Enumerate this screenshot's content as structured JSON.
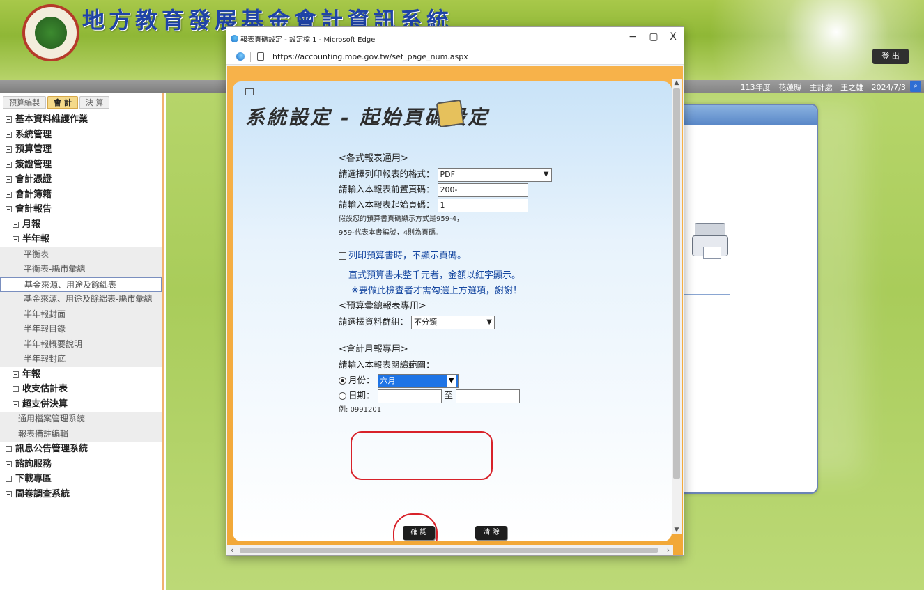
{
  "header": {
    "system_title": "地方教育發展基金會計資訊系統",
    "logout_label": "登 出",
    "colors": {
      "banner": "#a8c84a",
      "title": "#1f43a6"
    }
  },
  "infobar": {
    "year": "113年度",
    "county": "花蓮縣",
    "role": "主計處",
    "user": "王之雄",
    "date": "2024/7/3",
    "search_icon": "search-icon"
  },
  "sidebar": {
    "tabs": [
      "預算編製",
      "會 計",
      "決 算"
    ],
    "items": [
      {
        "label": "基本資料維護作業",
        "kind": "lvl1"
      },
      {
        "label": "系統管理",
        "kind": "lvl1"
      },
      {
        "label": "預算管理",
        "kind": "lvl1"
      },
      {
        "label": "簽證管理",
        "kind": "lvl1"
      },
      {
        "label": "會計憑證",
        "kind": "lvl1"
      },
      {
        "label": "會計簿籍",
        "kind": "lvl1"
      },
      {
        "label": "會計報告",
        "kind": "lvl1"
      },
      {
        "label": "月報",
        "kind": "lvl2"
      },
      {
        "label": "半年報",
        "kind": "lvl2"
      },
      {
        "label": "平衡表",
        "kind": "sub"
      },
      {
        "label": "平衡表-縣市彙總",
        "kind": "sub"
      },
      {
        "label": "基金來源、用途及餘絀表",
        "kind": "sub",
        "selected": true
      },
      {
        "label": "基金來源、用途及餘絀表-縣市彙總",
        "kind": "sub"
      },
      {
        "label": "半年報封面",
        "kind": "sub"
      },
      {
        "label": "半年報目錄",
        "kind": "sub"
      },
      {
        "label": "半年報概要說明",
        "kind": "sub"
      },
      {
        "label": "半年報封底",
        "kind": "sub"
      },
      {
        "label": "年報",
        "kind": "lvl2"
      },
      {
        "label": "收支估計表",
        "kind": "lvl2"
      },
      {
        "label": "超支併決算",
        "kind": "lvl2"
      },
      {
        "label": "通用檔案管理系統",
        "kind": "misc"
      },
      {
        "label": "報表備註編輯",
        "kind": "misc"
      },
      {
        "label": "訊息公告管理系統",
        "kind": "lvl1"
      },
      {
        "label": "諮詢服務",
        "kind": "lvl1"
      },
      {
        "label": "下載專區",
        "kind": "lvl1"
      },
      {
        "label": "問卷調查系統",
        "kind": "lvl1"
      }
    ]
  },
  "edge": {
    "window_title": "報表頁碼設定 - 設定檔 1 - Microsoft Edge",
    "url": "https://accounting.moe.gov.tw/set_page_num.aspx",
    "minimize": "−",
    "maximize": "▢",
    "close": "X"
  },
  "dialog": {
    "page_title": "系統設定 - 起始頁碼設定",
    "section_common": "<各式報表通用>",
    "format_label": "請選擇列印報表的格式：",
    "format_value": "PDF",
    "prefix_label": "請輸入本報表前置頁碼：",
    "prefix_value": "200-",
    "start_label": "請輸入本報表起始頁碼：",
    "start_value": "1",
    "note_line1": "假設您的預算書頁碼顯示方式是959-4，",
    "note_line2": "959-代表本書編號，4則為頁碼。",
    "checkbox1": "列印預算書時，不顯示頁碼。",
    "checkbox2": "直式預算書未整千元者，金額以紅字顯示。",
    "notice": "※要做此檢查者才需勾選上方選項，謝謝！",
    "section_budget": "<預算彙總報表專用>",
    "group_label": "請選擇資料群組：",
    "group_value": "不分類",
    "section_monthly": "<會計月報專用>",
    "range_label": "請輸入本報表閱讀範圍：",
    "month_label": "月份：",
    "month_value": "六月",
    "date_label": "日期：",
    "date_to": "至",
    "date_example": "例: 0991201",
    "confirm": "確 認",
    "clear": "清 除",
    "colors": {
      "highlight_oval": "#d8222a",
      "selected_option": "#1e74e6"
    }
  }
}
